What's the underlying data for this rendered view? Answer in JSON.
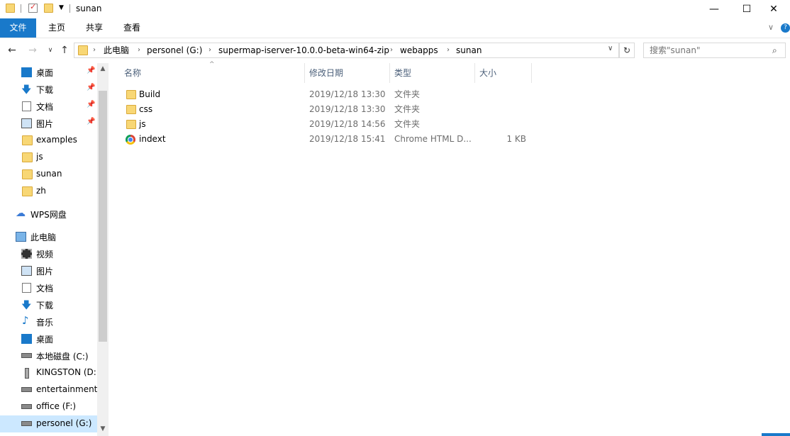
{
  "window": {
    "title": "sunan",
    "controls": {
      "minimize": "—",
      "maximize": "☐",
      "close": "✕"
    }
  },
  "ribbon": {
    "tabs": [
      {
        "label": "文件",
        "active": true
      },
      {
        "label": "主页"
      },
      {
        "label": "共享"
      },
      {
        "label": "查看"
      }
    ]
  },
  "address": {
    "crumbs": [
      "此电脑",
      "personel (G:)",
      "supermap-iserver-10.0.0-beta-win64-zip",
      "webapps",
      "sunan"
    ]
  },
  "search": {
    "placeholder": "搜索\"sunan\""
  },
  "nav": {
    "quick_access": [
      {
        "label": "桌面",
        "icon": "desktop-icon",
        "pinned": true
      },
      {
        "label": "下载",
        "icon": "download-icon",
        "pinned": true
      },
      {
        "label": "文档",
        "icon": "documents-icon",
        "pinned": true
      },
      {
        "label": "图片",
        "icon": "pictures-icon",
        "pinned": true
      },
      {
        "label": "examples",
        "icon": "folder-icon"
      },
      {
        "label": "js",
        "icon": "folder-icon"
      },
      {
        "label": "sunan",
        "icon": "folder-icon"
      },
      {
        "label": "zh",
        "icon": "folder-icon"
      }
    ],
    "wps": {
      "label": "WPS网盘",
      "icon": "cloud-icon"
    },
    "this_pc": {
      "label": "此电脑",
      "icon": "computer-icon"
    },
    "pc_items": [
      {
        "label": "视频",
        "icon": "video-icon"
      },
      {
        "label": "图片",
        "icon": "pictures-icon"
      },
      {
        "label": "文档",
        "icon": "documents-icon"
      },
      {
        "label": "下载",
        "icon": "download-icon"
      },
      {
        "label": "音乐",
        "icon": "music-icon"
      },
      {
        "label": "桌面",
        "icon": "desktop-icon"
      },
      {
        "label": "本地磁盘 (C:)",
        "icon": "drive-icon"
      },
      {
        "label": "KINGSTON (D:",
        "icon": "usb-drive-icon"
      },
      {
        "label": "entertainment (",
        "icon": "drive-icon"
      },
      {
        "label": "office (F:)",
        "icon": "drive-icon"
      },
      {
        "label": "personel (G:)",
        "icon": "drive-icon",
        "selected": true
      }
    ]
  },
  "columns": {
    "name": "名称",
    "date": "修改日期",
    "type": "类型",
    "size": "大小"
  },
  "files": [
    {
      "name": "Build",
      "date": "2019/12/18 13:30",
      "type": "文件夹",
      "size": "",
      "icon": "folder-icon"
    },
    {
      "name": "css",
      "date": "2019/12/18 13:30",
      "type": "文件夹",
      "size": "",
      "icon": "folder-icon"
    },
    {
      "name": "js",
      "date": "2019/12/18 14:56",
      "type": "文件夹",
      "size": "",
      "icon": "folder-icon"
    },
    {
      "name": "indext",
      "date": "2019/12/18 15:41",
      "type": "Chrome HTML D...",
      "size": "1 KB",
      "icon": "chrome-html-icon"
    }
  ]
}
